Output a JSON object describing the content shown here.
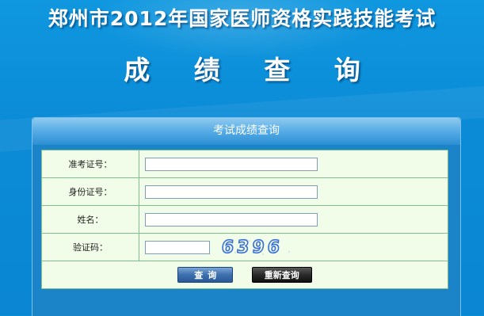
{
  "header": {
    "title": "郑州市2012年国家医师资格实践技能考试",
    "subtitle": "成 绩 查 询"
  },
  "panel": {
    "title": "考试成绩查询"
  },
  "form": {
    "exam_id_label": "准考证号：",
    "exam_id_value": "",
    "id_card_label": "身份证号：",
    "id_card_value": "",
    "name_label": "姓名：",
    "name_value": "",
    "captcha_label": "验证码：",
    "captcha_value": "",
    "captcha_image_text": "6396"
  },
  "buttons": {
    "query": "查询",
    "reset": "重新查询"
  },
  "colors": {
    "background": "#0d8fd8",
    "form_bg": "#f1fde9",
    "form_border": "#7fbf8f",
    "query_button": "#3d6fae",
    "reset_button": "#1a1a1a",
    "captcha_text": "#3a6fd8"
  }
}
